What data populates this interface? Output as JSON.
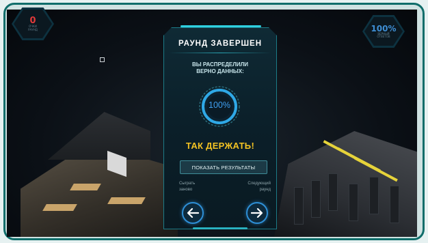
{
  "hud": {
    "left": {
      "value": "0",
      "label_line1": "ОЧКИ",
      "label_line2": "РАУНД"
    },
    "right": {
      "value": "100%",
      "label_line1": "ВЕРНЫЙ",
      "label_line2": "ОТВЕТОВ"
    }
  },
  "dialog": {
    "title": "РАУНД ЗАВЕРШЕН",
    "subtitle_line1": "ВЫ РАСПРЕДЕЛИЛИ",
    "subtitle_line2": "ВЕРНО ДАННЫХ:",
    "score_value": "100%",
    "score_fraction": 1.0,
    "praise": "ТАК ДЕРЖАТЬ!",
    "show_results_label": "ПОКАЗАТЬ РЕЗУЛЬТАТЫ",
    "replay_line1": "Сыграть",
    "replay_line2": "заново",
    "next_line1": "Следующий",
    "next_line2": "раунд"
  },
  "icons": {
    "prev": "arrow-left-icon",
    "next": "arrow-right-icon"
  },
  "colors": {
    "accent": "#2e8fd6",
    "praise": "#f4c323",
    "hud_left_value": "#e03a3a",
    "frame_border": "#0f6d6a"
  }
}
